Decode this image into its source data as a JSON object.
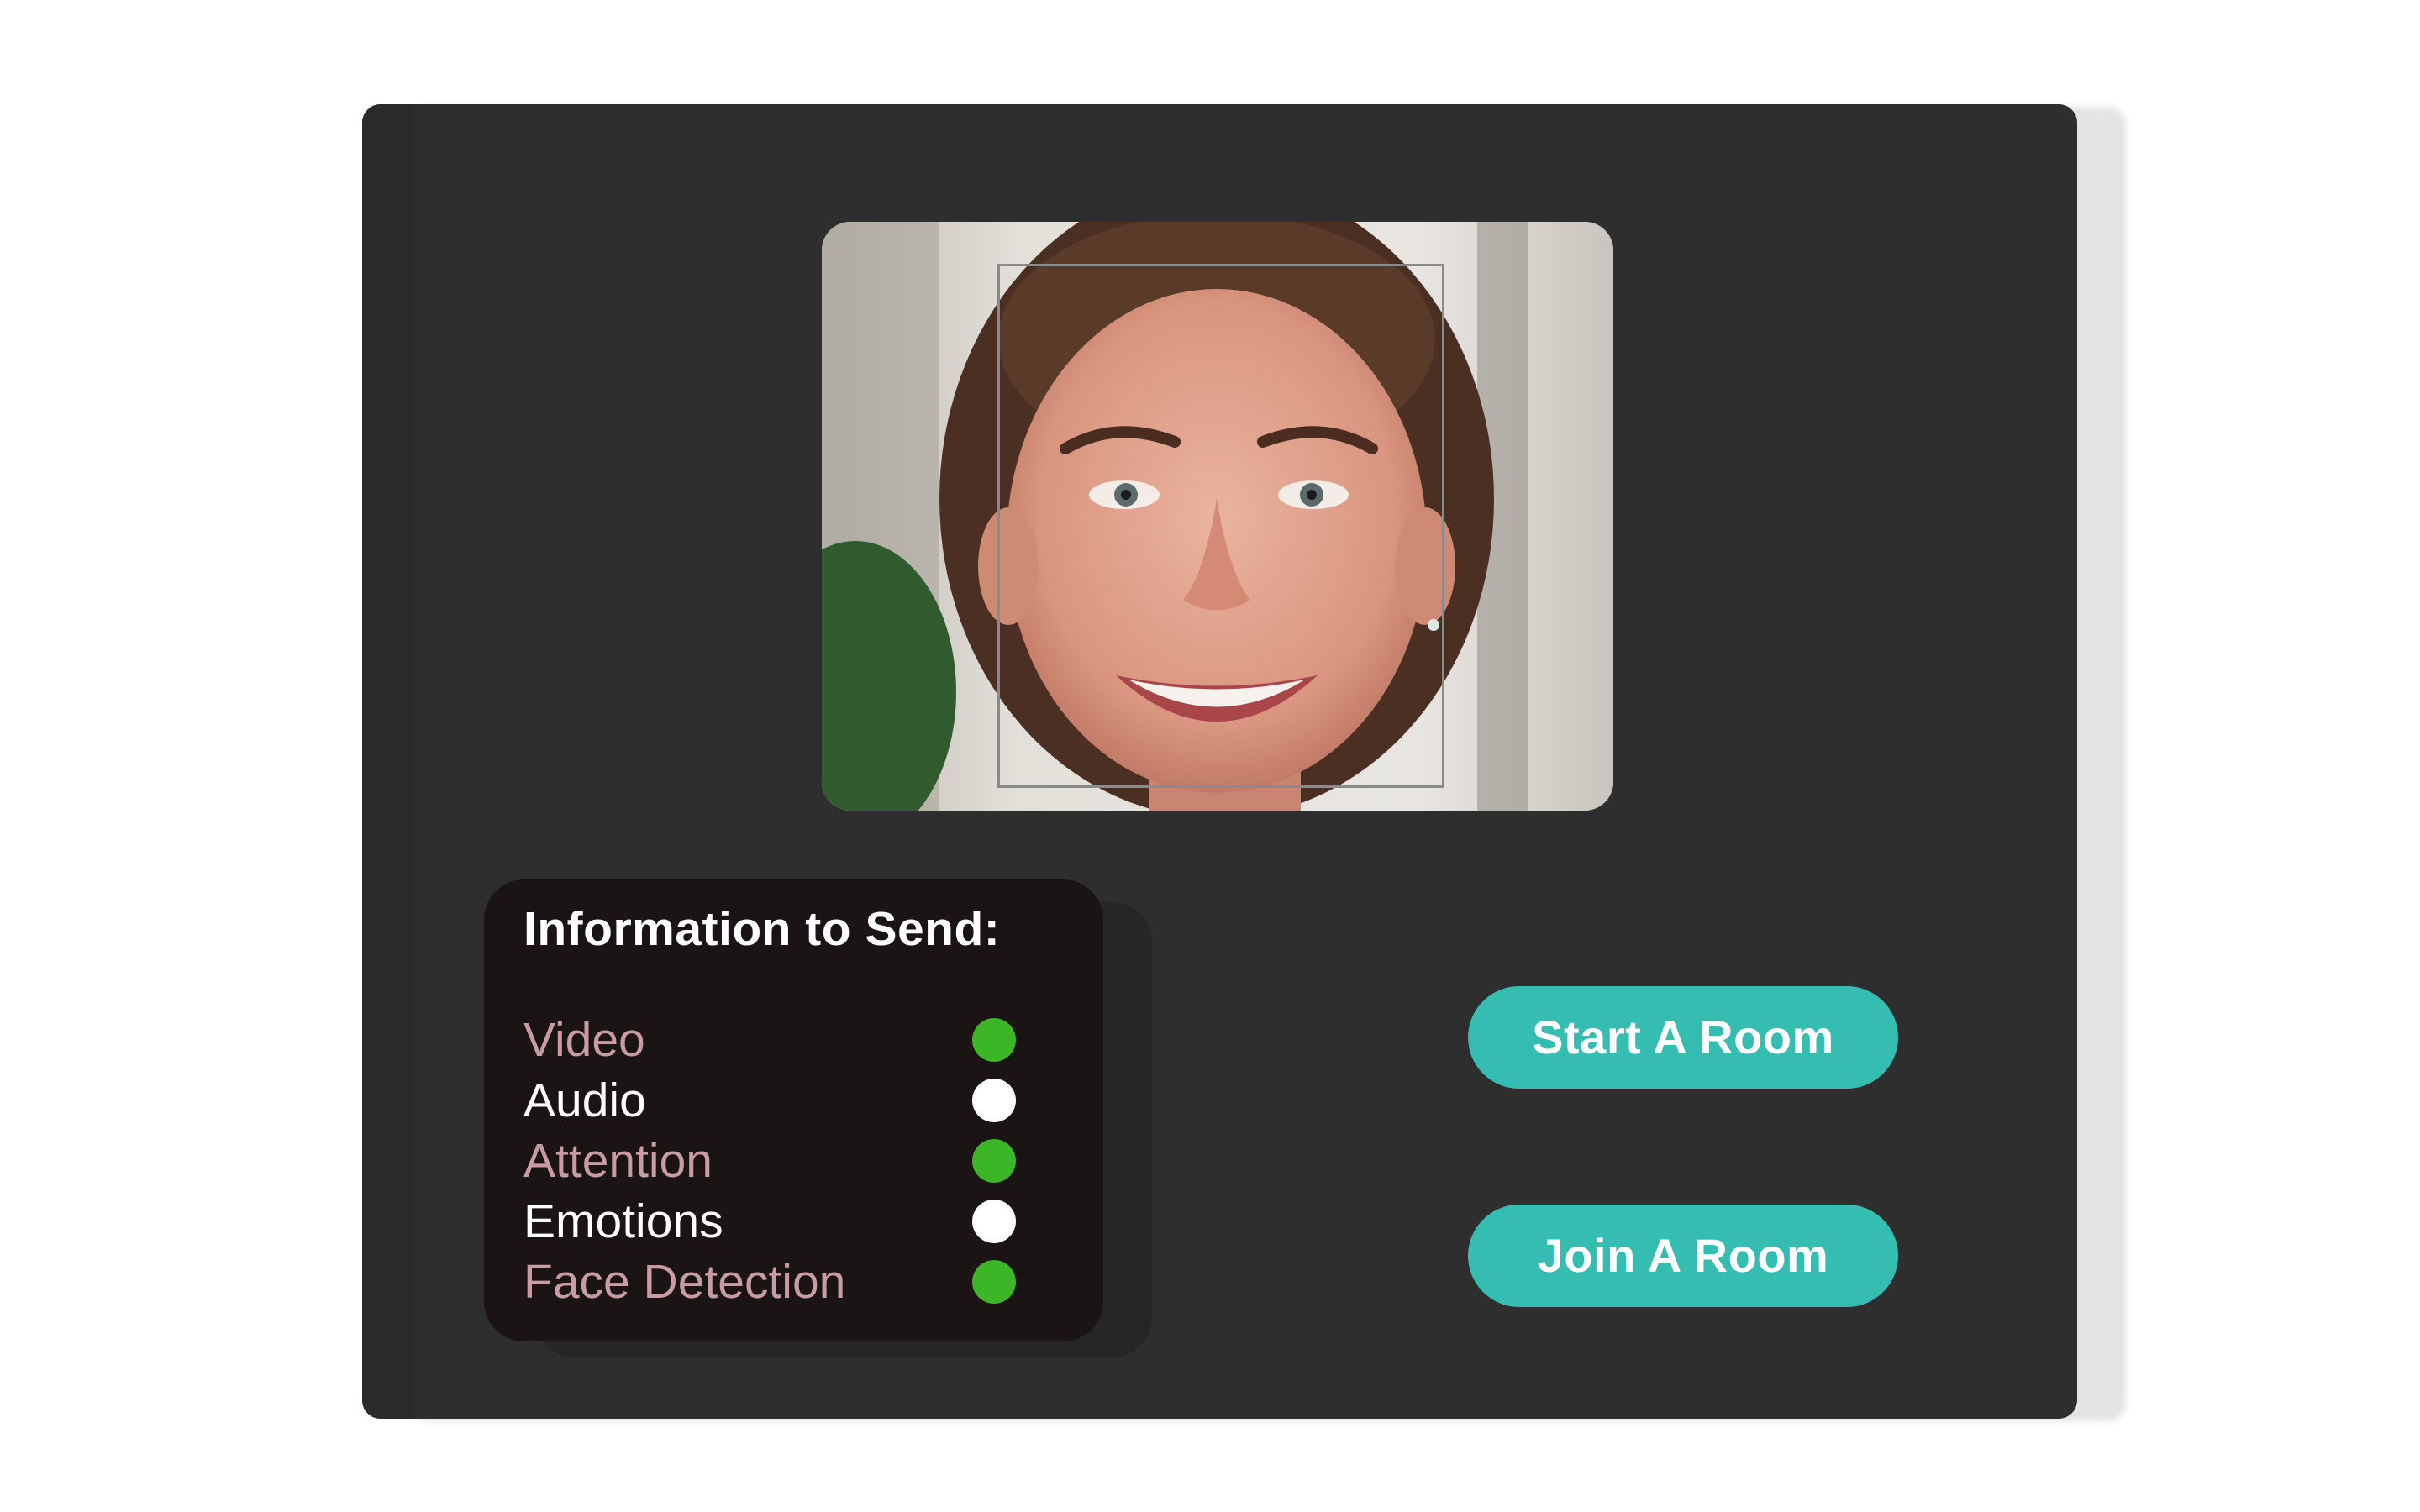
{
  "info_panel": {
    "title": "Information to Send:",
    "options": [
      {
        "label": "Video",
        "enabled": true
      },
      {
        "label": "Audio",
        "enabled": false
      },
      {
        "label": "Attention",
        "enabled": true
      },
      {
        "label": "Emotions",
        "enabled": false
      },
      {
        "label": "Face Detection",
        "enabled": true
      }
    ]
  },
  "actions": {
    "start_label": "Start A Room",
    "join_label": "Join A Room"
  },
  "colors": {
    "panel_bg": "#2e2e2e",
    "card_bg": "#1b1414",
    "enabled_label": "#c89ca2",
    "disabled_label": "#ffffff",
    "enabled_dot": "#3cb527",
    "disabled_dot": "#ffffff",
    "button_bg": "#36bdb1"
  }
}
